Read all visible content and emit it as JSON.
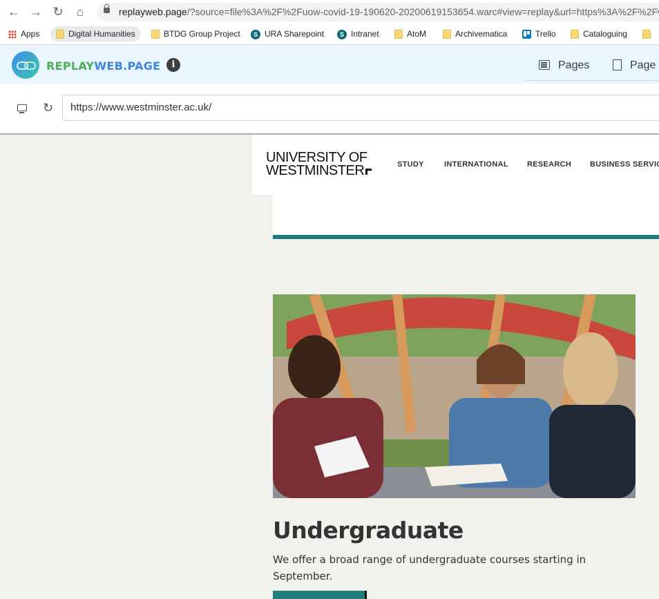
{
  "browser": {
    "url_host": "replayweb.page",
    "url_rest": "/?source=file%3A%2F%2Fuow-covid-19-190620-20200619153654.warc#view=replay&url=https%3A%2F%2Fww"
  },
  "bookmarks": [
    {
      "label": "Apps",
      "icon": "apps-grid-icon"
    },
    {
      "label": "Digital Humanities",
      "icon": "folder-icon"
    },
    {
      "label": "BTDG Group Project",
      "icon": "folder-icon"
    },
    {
      "label": "URA Sharepoint",
      "icon": "sharepoint-icon"
    },
    {
      "label": "Intranet",
      "icon": "sharepoint-icon"
    },
    {
      "label": "AtoM",
      "icon": "folder-icon"
    },
    {
      "label": "Archivematica",
      "icon": "folder-icon"
    },
    {
      "label": "Trello",
      "icon": "trello-icon"
    },
    {
      "label": "Cataloguing",
      "icon": "folder-icon"
    }
  ],
  "replay": {
    "brand_part1": "REPLAY",
    "brand_part2": "WEB.PAGE",
    "tab_pages": "Pages",
    "tab_page": "Page",
    "archived_url": "https://www.westminster.ac.uk/"
  },
  "site": {
    "logo_line1": "UNIVERSITY OF",
    "logo_line2": "WESTMINSTER",
    "nav": [
      "STUDY",
      "INTERNATIONAL",
      "RESEARCH",
      "BUSINESS SERVIC"
    ],
    "section_title": "Undergraduate",
    "section_desc": "We offer a broad range of undergraduate courses starting in September.",
    "accent_color": "#1f7e7a"
  }
}
